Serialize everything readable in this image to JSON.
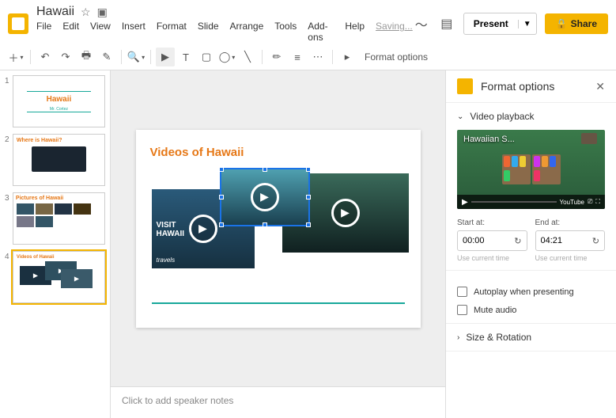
{
  "header": {
    "doc_title": "Hawaii",
    "saving": "Saving...",
    "present": "Present",
    "share": "Share"
  },
  "menus": [
    "File",
    "Edit",
    "View",
    "Insert",
    "Format",
    "Slide",
    "Arrange",
    "Tools",
    "Add-ons",
    "Help"
  ],
  "toolbar": {
    "format_options": "Format options"
  },
  "thumbs": {
    "1": {
      "title": "Hawaii",
      "subtitle": "Mr. Cortez"
    },
    "2": {
      "title": "Where is Hawaii?"
    },
    "3": {
      "title": "Pictures of Hawaii"
    },
    "4": {
      "title": "Videos of Hawaii"
    }
  },
  "slide": {
    "title": "Videos of Hawaii",
    "v1_caption_top": "VISIT",
    "v1_caption_mid": "HAWAII",
    "v1_caption_bot": "travels"
  },
  "notes": {
    "placeholder": "Click to add speaker notes"
  },
  "panel": {
    "title": "Format options",
    "video_playback": "Video playback",
    "preview_title": "Hawaiian S...",
    "youtube": "YouTube",
    "start_at": "Start at:",
    "end_at": "End at:",
    "start_val": "00:00",
    "end_val": "04:21",
    "use_current": "Use current time",
    "autoplay": "Autoplay when presenting",
    "mute": "Mute audio",
    "size_rotation": "Size & Rotation"
  }
}
